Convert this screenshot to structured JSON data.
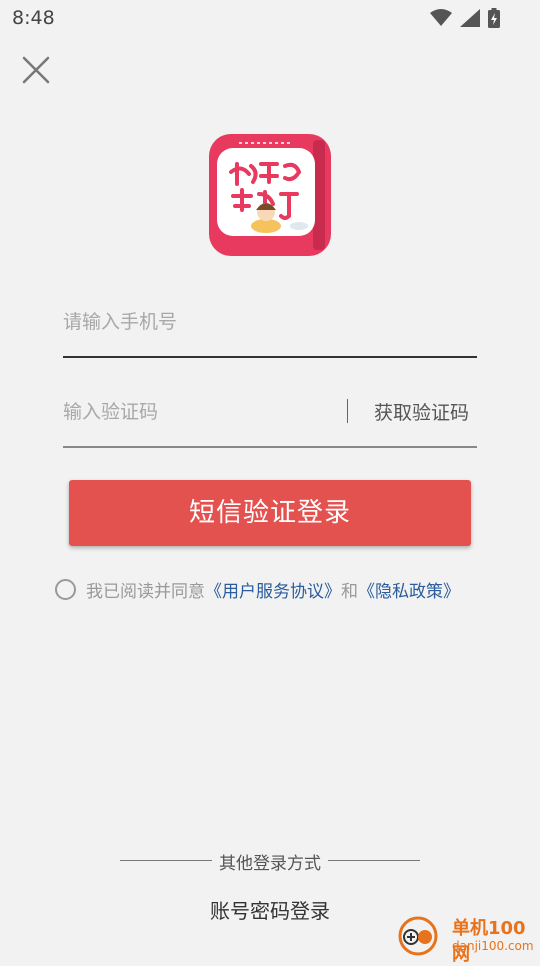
{
  "status_bar": {
    "time": "8:48",
    "icons": [
      "wifi-icon",
      "signal-icon",
      "battery-charging-icon"
    ]
  },
  "header": {
    "close_icon": "close-icon"
  },
  "logo": {
    "type": "app-icon",
    "colors": {
      "pink": "#e8395f",
      "bg": "#ffffff"
    }
  },
  "form": {
    "phone": {
      "placeholder": "请输入手机号",
      "value": ""
    },
    "code": {
      "placeholder": "输入验证码",
      "value": ""
    },
    "get_code_label": "获取验证码"
  },
  "login_button": {
    "label": "短信验证登录",
    "color": "#e45250"
  },
  "agreement": {
    "checked": false,
    "prefix": "我已阅读并同意",
    "terms_link": "《用户服务协议》",
    "and": "和",
    "privacy_link": "《隐私政策》",
    "link_color": "#2a5c9e"
  },
  "other_login": {
    "divider_label": "其他登录方式",
    "account_login_label": "账号密码登录"
  },
  "watermark": {
    "title": "单机100网",
    "url": "danji100.com",
    "color": "#e8731d"
  }
}
